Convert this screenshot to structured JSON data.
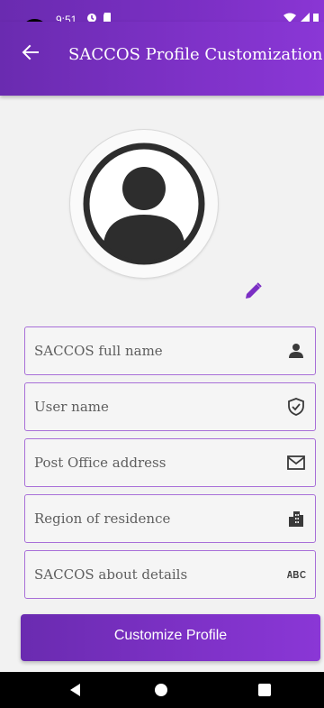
{
  "status_bar": {
    "time": "9:51",
    "icons_left": [
      "sync-icon",
      "sd-card-icon"
    ],
    "icons_right": [
      "wifi-icon",
      "signal-icon",
      "battery-icon"
    ]
  },
  "app_bar": {
    "title": "SACCOS Profile Customization",
    "back_icon": "arrow-left-icon"
  },
  "profile": {
    "avatar_icon": "account-circle-icon",
    "edit_icon": "pencil-icon"
  },
  "form": {
    "fields": [
      {
        "label": "SACCOS full name",
        "icon": "person-icon"
      },
      {
        "label": "User name",
        "icon": "verified-user-icon"
      },
      {
        "label": "Post Office address",
        "icon": "mail-icon"
      },
      {
        "label": "Region of residence",
        "icon": "apartment-icon"
      },
      {
        "label": "SACCOS about details",
        "icon": "abc-icon"
      }
    ]
  },
  "actions": {
    "customize_label": "Customize Profile"
  },
  "colors": {
    "primary": "#7b2fc4",
    "primary_light": "#a86fd8",
    "background": "#f2f2f2"
  }
}
